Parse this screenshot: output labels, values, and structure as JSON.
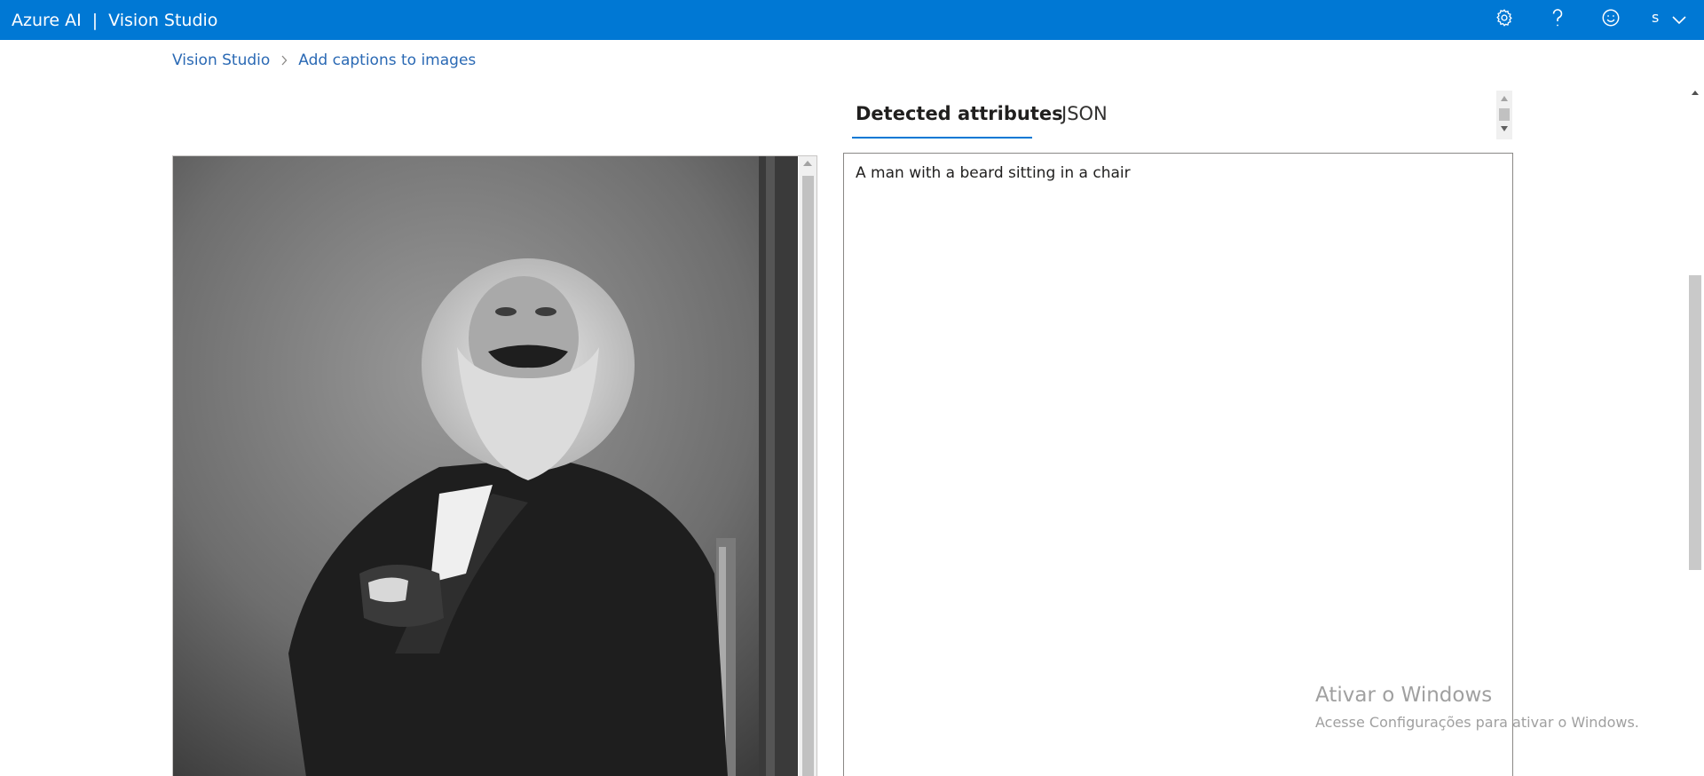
{
  "header": {
    "brand": "Azure AI",
    "separator": "|",
    "product": "Vision Studio",
    "user_initial": "s",
    "accent_color": "#0078d4",
    "icons": [
      "gear-icon",
      "help-icon",
      "feedback-smiley-icon",
      "chevron-down-icon"
    ]
  },
  "breadcrumb": {
    "items": [
      "Vision Studio",
      "Add captions to images"
    ]
  },
  "tabs": [
    {
      "label": "Detected attributes",
      "active": true
    },
    {
      "label": "JSON",
      "active": false
    }
  ],
  "result": {
    "caption": "A man with a beard sitting in a chair"
  },
  "watermark": {
    "title": "Ativar o Windows",
    "subtitle": "Acesse Configurações para ativar o Windows."
  }
}
